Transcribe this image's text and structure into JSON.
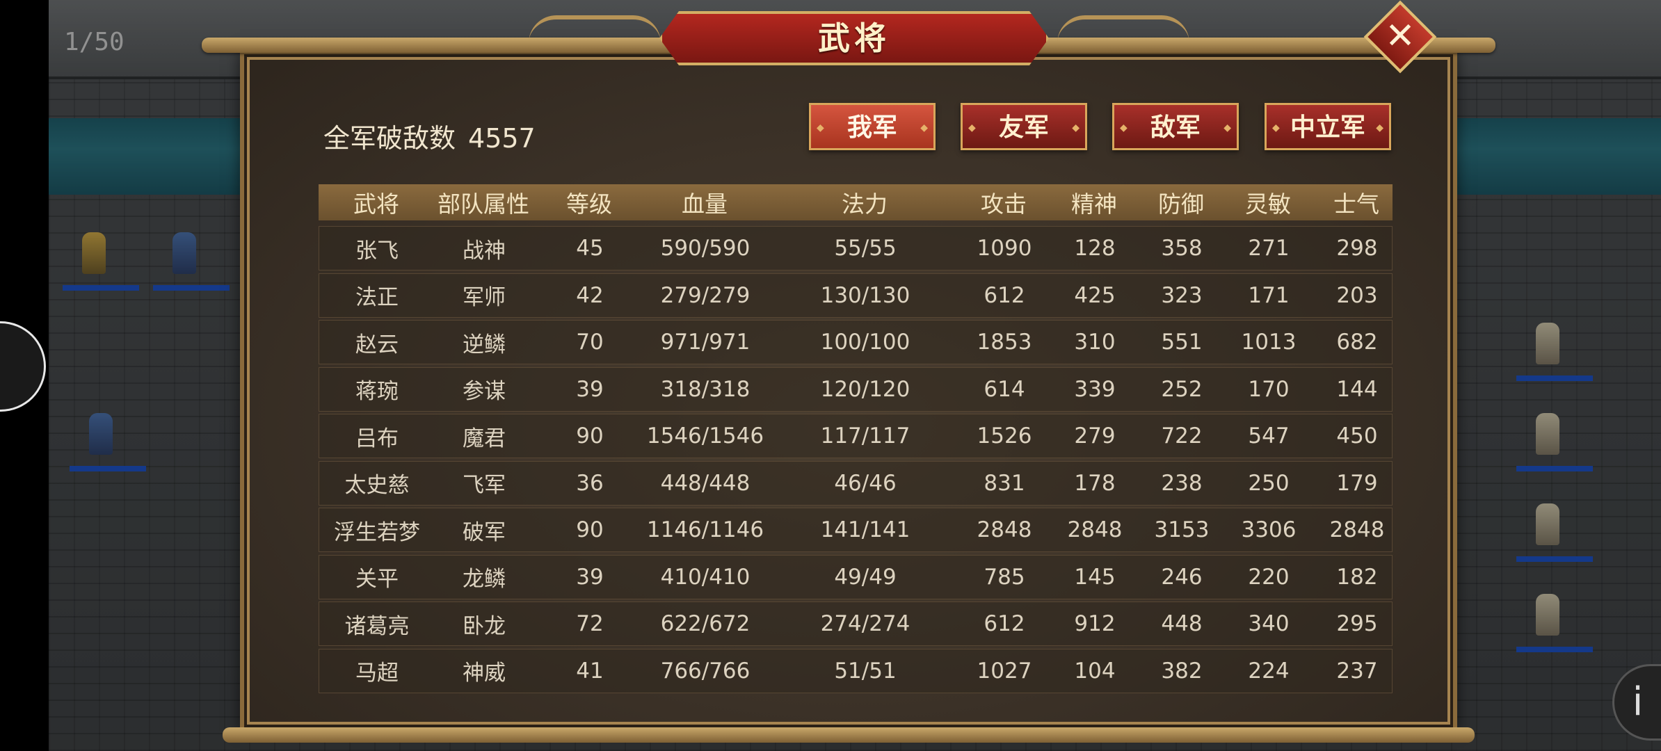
{
  "pager": "1/50",
  "dialog": {
    "title": "武将",
    "close_icon": "✕",
    "kills_label": "全军破敌数",
    "kills_value": "4557"
  },
  "tabs": [
    {
      "label": "我军",
      "active": true
    },
    {
      "label": "友军",
      "active": false
    },
    {
      "label": "敌军",
      "active": false
    },
    {
      "label": "中立军",
      "active": false
    }
  ],
  "table": {
    "headers": [
      "武将",
      "部队属性",
      "等级",
      "血量",
      "法力",
      "攻击",
      "精神",
      "防御",
      "灵敏",
      "士气"
    ],
    "rows": [
      [
        "张飞",
        "战神",
        "45",
        "590/590",
        "55/55",
        "1090",
        "128",
        "358",
        "271",
        "298"
      ],
      [
        "法正",
        "军师",
        "42",
        "279/279",
        "130/130",
        "612",
        "425",
        "323",
        "171",
        "203"
      ],
      [
        "赵云",
        "逆鳞",
        "70",
        "971/971",
        "100/100",
        "1853",
        "310",
        "551",
        "1013",
        "682"
      ],
      [
        "蒋琬",
        "参谋",
        "39",
        "318/318",
        "120/120",
        "614",
        "339",
        "252",
        "170",
        "144"
      ],
      [
        "吕布",
        "魔君",
        "90",
        "1546/1546",
        "117/117",
        "1526",
        "279",
        "722",
        "547",
        "450"
      ],
      [
        "太史慈",
        "飞军",
        "36",
        "448/448",
        "46/46",
        "831",
        "178",
        "238",
        "250",
        "179"
      ],
      [
        "浮生若梦",
        "破军",
        "90",
        "1146/1146",
        "141/141",
        "2848",
        "2848",
        "3153",
        "3306",
        "2848"
      ],
      [
        "关平",
        "龙鳞",
        "39",
        "410/410",
        "49/49",
        "785",
        "145",
        "246",
        "220",
        "182"
      ],
      [
        "诸葛亮",
        "卧龙",
        "72",
        "622/672",
        "274/274",
        "612",
        "912",
        "448",
        "340",
        "295"
      ],
      [
        "马超",
        "神威",
        "41",
        "766/766",
        "51/51",
        "1027",
        "104",
        "382",
        "224",
        "237"
      ]
    ]
  },
  "info_icon": "i",
  "colors": {
    "tab_active": "#d5553f",
    "tab": "#a8302a",
    "header_bar": "#8a6a3e",
    "frame": "#a68450"
  }
}
